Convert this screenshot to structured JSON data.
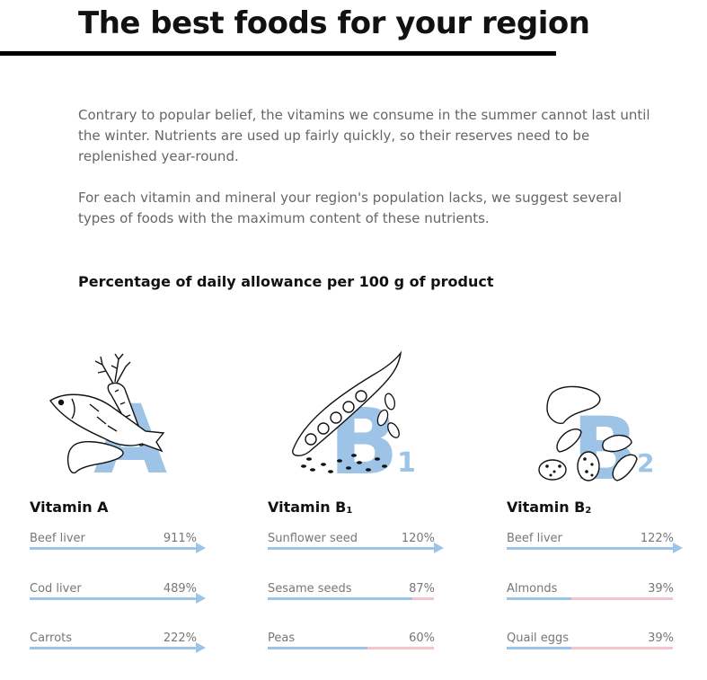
{
  "title": "The best foods for your region",
  "intro": [
    "Contrary to popular belief, the vitamins we consume in the summer cannot last until the winter. Nutrients are used up fairly quickly, so their reserves need to be replenished year-round.",
    "For each vitamin and mineral your region's population lacks, we suggest several types of foods with the maximum content of these nutrients."
  ],
  "subtitle": "Percentage of daily allowance per 100 g of product",
  "colors": {
    "bar": "#9dc3e6",
    "track": "#f2c4cc",
    "letter": "#9dc3e6"
  },
  "vitamins": [
    {
      "name": "Vitamin A",
      "sub": "",
      "illustration": {
        "letter": "A",
        "index": "",
        "icons": [
          "fish-icon",
          "carrot-icon",
          "liver-icon"
        ]
      },
      "foods": [
        {
          "name": "Beef liver",
          "percent": "911%",
          "value": 911
        },
        {
          "name": "Cod liver",
          "percent": "489%",
          "value": 489
        },
        {
          "name": "Carrots",
          "percent": "222%",
          "value": 222
        }
      ]
    },
    {
      "name": "Vitamin B",
      "sub": "1",
      "illustration": {
        "letter": "B",
        "index": "1",
        "icons": [
          "peapod-icon",
          "sunflower-seeds-icon",
          "sesame-seeds-icon"
        ]
      },
      "foods": [
        {
          "name": "Sunflower seed",
          "percent": "120%",
          "value": 120
        },
        {
          "name": "Sesame seeds",
          "percent": "87%",
          "value": 87
        },
        {
          "name": "Peas",
          "percent": "60%",
          "value": 60
        }
      ]
    },
    {
      "name": "Vitamin B",
      "sub": "2",
      "illustration": {
        "letter": "B",
        "index": "2",
        "icons": [
          "liver-icon",
          "almond-icon",
          "quail-egg-icon"
        ]
      },
      "foods": [
        {
          "name": "Beef liver",
          "percent": "122%",
          "value": 122
        },
        {
          "name": "Almonds",
          "percent": "39%",
          "value": 39
        },
        {
          "name": "Quail eggs",
          "percent": "39%",
          "value": 39
        }
      ]
    }
  ]
}
